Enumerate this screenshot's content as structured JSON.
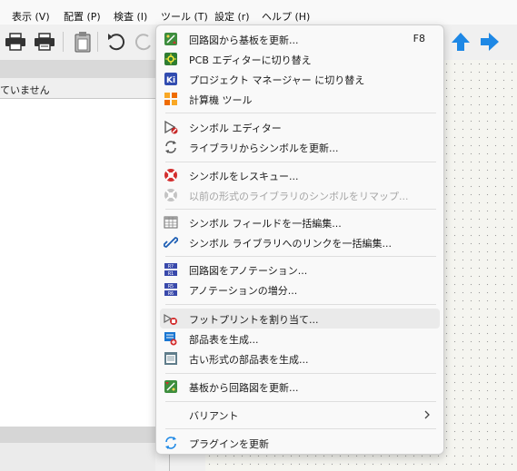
{
  "menubar": {
    "items": [
      "表示 (V)",
      "配置 (P)",
      "検査 (I)",
      "ツール (T)",
      "設定 (r)",
      "ヘルプ (H)"
    ]
  },
  "left_panel": {
    "header_text": "ていません"
  },
  "tools_menu": {
    "items": [
      {
        "label": "回路図から基板を更新...",
        "shortcut": "F8",
        "icon": "update-pcb-icon"
      },
      {
        "label": "PCB エディターに切り替え",
        "icon": "pcb-editor-icon"
      },
      {
        "label": "プロジェクト マネージャー に切り替え",
        "icon": "kicad-icon"
      },
      {
        "label": "計算機 ツール",
        "icon": "calculator-icon"
      },
      {
        "label": "シンボル エディター",
        "icon": "symbol-editor-icon"
      },
      {
        "label": "ライブラリからシンボルを更新...",
        "icon": "refresh-icon"
      },
      {
        "label": "シンボルをレスキュー...",
        "icon": "rescue-icon"
      },
      {
        "label": "以前の形式のライブラリのシンボルをリマップ...",
        "icon": "remap-icon",
        "disabled": true
      },
      {
        "label": "シンボル フィールドを一括編集...",
        "icon": "table-icon"
      },
      {
        "label": "シンボル ライブラリへのリンクを一括編集...",
        "icon": "link-icon"
      },
      {
        "label": "回路図をアノテーション...",
        "icon": "annotate-icon"
      },
      {
        "label": "アノテーションの増分...",
        "icon": "increment-icon"
      },
      {
        "label": "フットプリントを割り当て...",
        "icon": "footprint-icon"
      },
      {
        "label": "部品表を生成...",
        "icon": "bom-icon"
      },
      {
        "label": "古い形式の部品表を生成...",
        "icon": "legacy-bom-icon"
      },
      {
        "label": "基板から回路図を更新...",
        "icon": "update-sch-icon"
      },
      {
        "label": "バリアント",
        "icon": "none",
        "submenu": true
      },
      {
        "label": "プラグインを更新",
        "icon": "refresh-icon"
      }
    ]
  },
  "colors": {
    "accent_blue": "#1e88e5",
    "menu_bg": "#f9f9f9",
    "disabled_text": "#a5a5a5"
  }
}
